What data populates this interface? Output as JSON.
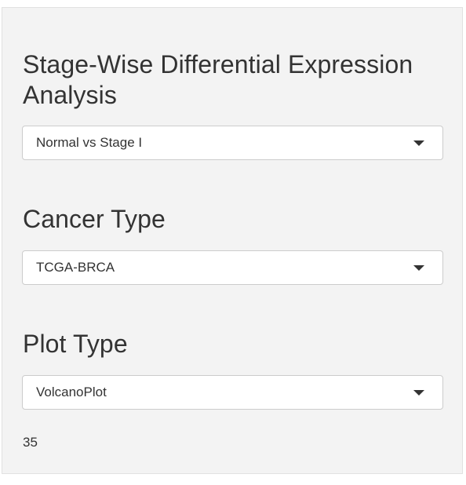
{
  "panel": {
    "stage_title": "Stage-Wise Differential Expression Analysis",
    "stage_select": {
      "value": "Normal vs Stage I",
      "icon": "caret-down-icon"
    },
    "cancer_title": "Cancer Type",
    "cancer_select": {
      "value": "TCGA-BRCA",
      "icon": "caret-down-icon"
    },
    "plot_title": "Plot Type",
    "plot_select": {
      "value": "VolcanoPlot",
      "icon": "caret-down-icon"
    },
    "value_text": "35"
  }
}
